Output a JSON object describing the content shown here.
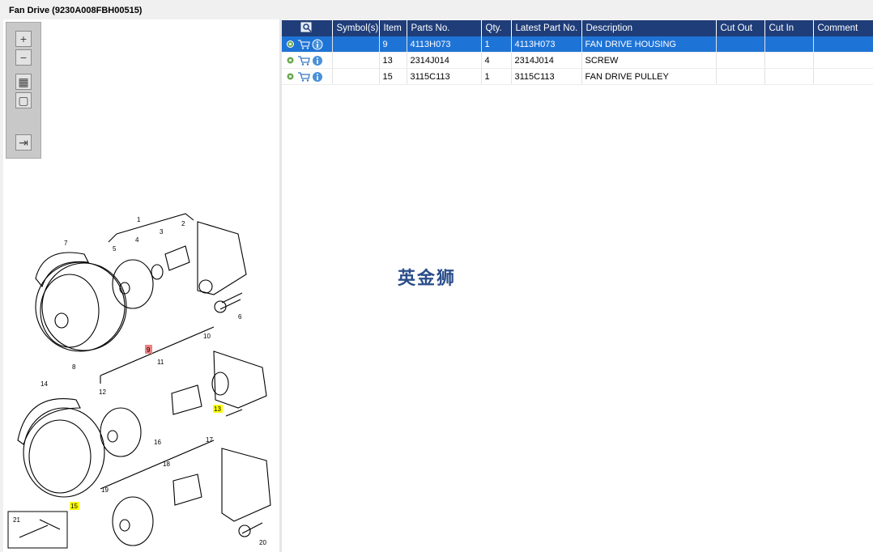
{
  "title": "Fan Drive (9230A008FBH00515)",
  "toolbar": {
    "buttons": [
      {
        "name": "zoom-in-icon",
        "glyph": "+"
      },
      {
        "name": "zoom-out-icon",
        "glyph": "−"
      },
      {
        "name": "fit-grid-icon",
        "glyph": "▦"
      },
      {
        "name": "fit-window-icon",
        "glyph": "▢"
      },
      {
        "name": "export-icon",
        "glyph": "⇥"
      }
    ]
  },
  "table": {
    "columns": [
      "",
      "Symbol(s)",
      "Item",
      "Parts No.",
      "Qty.",
      "Latest Part No.",
      "Description",
      "Cut Out",
      "Cut In",
      "Comment"
    ],
    "rows": [
      {
        "item": "9",
        "part_no": "4113H073",
        "qty": "1",
        "latest": "4113H073",
        "desc": "FAN DRIVE HOUSING",
        "selected": true
      },
      {
        "item": "13",
        "part_no": "2314J014",
        "qty": "4",
        "latest": "2314J014",
        "desc": "SCREW",
        "selected": false
      },
      {
        "item": "15",
        "part_no": "3115C113",
        "qty": "1",
        "latest": "3115C113",
        "desc": "FAN DRIVE PULLEY",
        "selected": false
      }
    ]
  },
  "watermark": "英金狮",
  "diagram": {
    "callouts": [
      "1",
      "2",
      "3",
      "4",
      "5",
      "6",
      "7",
      "8",
      "9",
      "10",
      "11",
      "12",
      "13",
      "14",
      "15",
      "16",
      "17",
      "18",
      "19",
      "20",
      "21"
    ],
    "highlighted": {
      "9": "#f08080",
      "13": "#ffff00",
      "15": "#ffff00"
    }
  },
  "colors": {
    "header": "#1f3d78",
    "selected_row": "#1e73d6"
  }
}
